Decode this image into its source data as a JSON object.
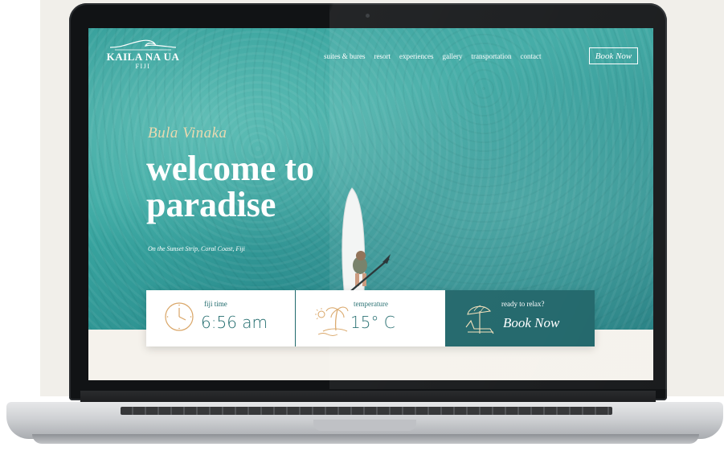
{
  "logo": {
    "name": "KAILA NA UA",
    "sub": "FIJI"
  },
  "nav": {
    "items": [
      "suites & bures",
      "resort",
      "experiences",
      "gallery",
      "transportation",
      "contact"
    ],
    "book_label": "Book Now"
  },
  "hero": {
    "greeting": "Bula Vinaka",
    "headline_line1": "welcome to",
    "headline_line2": "paradise",
    "location": "On the Sunset Strip, Coral Coast, Fiji"
  },
  "infobar": {
    "time": {
      "label": "fiji time",
      "value": "6:56 am",
      "icon": "clock-icon"
    },
    "temperature": {
      "label": "temperature",
      "value": "15° C",
      "icon": "palm-island-icon"
    },
    "booking": {
      "label": "ready to relax?",
      "value": "Book Now",
      "icon": "beach-umbrella-icon"
    }
  },
  "colors": {
    "ocean": "#2e9a96",
    "deep_teal": "#1a6266",
    "gold": "#d9a566",
    "cream": "#f5f2ec"
  }
}
